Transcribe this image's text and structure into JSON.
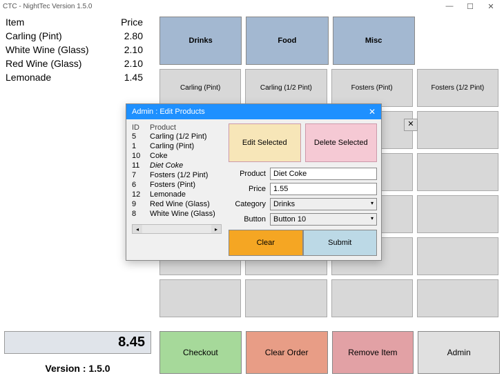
{
  "window": {
    "title": "CTC - NightTec   Version 1.5.0"
  },
  "order": {
    "headers": {
      "item": "Item",
      "price": "Price"
    },
    "rows": [
      {
        "item": "Carling (Pint)",
        "price": "2.80"
      },
      {
        "item": "White Wine (Glass)",
        "price": "2.10"
      },
      {
        "item": "Red Wine (Glass)",
        "price": "2.10"
      },
      {
        "item": "Lemonade",
        "price": "1.45"
      }
    ],
    "total": "8.45"
  },
  "version": "Version : 1.5.0",
  "categories": [
    "Drinks",
    "Food",
    "Misc"
  ],
  "products": [
    "Carling (Pint)",
    "Carling (1/2 Pint)",
    "Fosters (Pint)",
    "Fosters (1/2 Pint)"
  ],
  "bottom": {
    "checkout": "Checkout",
    "clear_order": "Clear Order",
    "remove_item": "Remove Item",
    "admin": "Admin"
  },
  "dialog": {
    "title": "Admin : Edit Products",
    "list_headers": {
      "id": "ID",
      "product": "Product"
    },
    "list": [
      {
        "id": "5",
        "name": "Carling (1/2 Pint)"
      },
      {
        "id": "1",
        "name": "Carling (Pint)"
      },
      {
        "id": "10",
        "name": "Coke"
      },
      {
        "id": "11",
        "name": "Diet Coke"
      },
      {
        "id": "7",
        "name": "Fosters (1/2 Pint)"
      },
      {
        "id": "6",
        "name": "Fosters (Pint)"
      },
      {
        "id": "12",
        "name": "Lemonade"
      },
      {
        "id": "9",
        "name": "Red Wine (Glass)"
      },
      {
        "id": "8",
        "name": "White Wine (Glass)"
      }
    ],
    "edit_btn": "Edit Selected",
    "delete_btn": "Delete Selected",
    "labels": {
      "product": "Product",
      "price": "Price",
      "category": "Category",
      "button": "Button"
    },
    "fields": {
      "product": "Diet Coke",
      "price": "1.55",
      "category": "Drinks",
      "button": "Button 10"
    },
    "clear": "Clear",
    "submit": "Submit"
  }
}
